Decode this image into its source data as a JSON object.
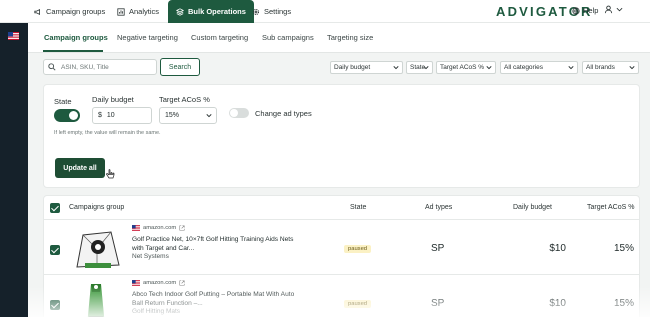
{
  "topnav": {
    "items": [
      {
        "label": "Campaign groups",
        "icon": "megaphone-icon"
      },
      {
        "label": "Analytics",
        "icon": "chart-icon"
      },
      {
        "label": "Bulk Operations",
        "icon": "layers-icon",
        "active": true
      },
      {
        "label": "Settings",
        "icon": "gear-icon"
      }
    ],
    "logo": "ADVIGATOR",
    "help": "Help"
  },
  "subtabs": [
    "Campaign groups",
    "Negative targeting",
    "Custom targeting",
    "Sub campaigns",
    "Targeting size"
  ],
  "search": {
    "placeholder": "ASIN, SKU, Title",
    "button": "Search"
  },
  "filters": [
    "Daily budget",
    "State",
    "Target ACoS %",
    "All categories",
    "All brands"
  ],
  "bulk_edit": {
    "state_label": "State",
    "budget_label": "Daily budget",
    "budget_currency": "$",
    "budget_value": "10",
    "acos_label": "Target ACoS %",
    "acos_value": "15%",
    "ad_types_label": "Change ad types",
    "hint": "If left empty, the value will remain the same.",
    "update_button": "Update all"
  },
  "table": {
    "headers": [
      "Campaigns group",
      "State",
      "Ad types",
      "Daily budget",
      "Target ACoS %"
    ],
    "rows": [
      {
        "source": "amazon.com",
        "title_line1": "Golf Practice Net, 10×7ft Golf Hitting Training Aids Nets",
        "title_line2": "with Target and Car...",
        "brand": "Net Systems",
        "state": "paused",
        "ad_types": "SP",
        "budget": "$10",
        "acos": "15%"
      },
      {
        "source": "amazon.com",
        "title_line1": "Abco Tech Indoor Golf Putting – Portable Mat With Auto",
        "title_line2": "Ball Return Function –...",
        "brand": "Golf Hitting Mats",
        "state": "paused",
        "ad_types": "SP",
        "budget": "$10",
        "acos": "15%"
      }
    ]
  },
  "colors": {
    "accent": "#1e5a3f",
    "rail": "#15212a",
    "badge_bg": "#fbf1c4"
  }
}
